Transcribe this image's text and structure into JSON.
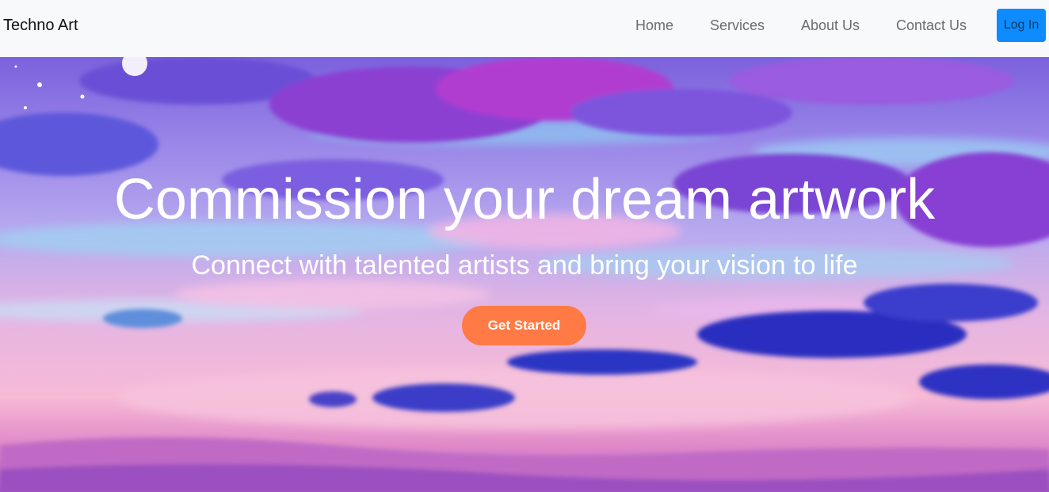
{
  "navbar": {
    "brand": "Techno Art",
    "links": [
      {
        "label": "Home"
      },
      {
        "label": "Services"
      },
      {
        "label": "About Us"
      },
      {
        "label": "Contact Us"
      }
    ],
    "login_label": "Log In"
  },
  "hero": {
    "title": "Commission your dream artwork",
    "subtitle": "Connect with talented artists and bring your vision to life",
    "cta_label": "Get Started",
    "background": "painted-sunset-sky-clouds"
  },
  "colors": {
    "navbar_bg": "#f8f9fa",
    "login_button": "#0d8bff",
    "cta_button": "#ff7a45",
    "hero_text": "#ffffff"
  }
}
